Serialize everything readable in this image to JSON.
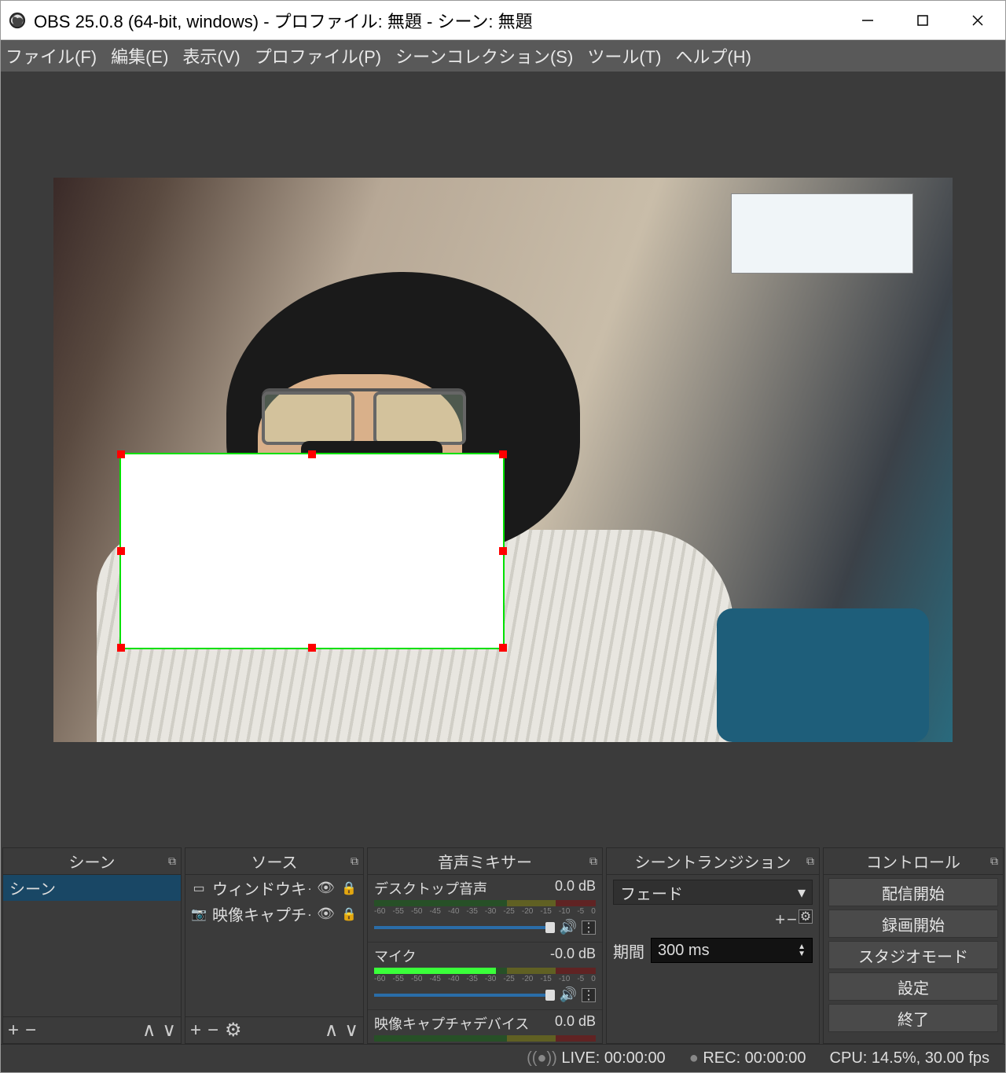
{
  "window": {
    "title": "OBS 25.0.8 (64-bit, windows) - プロファイル: 無題 - シーン: 無題"
  },
  "menubar": [
    "ファイル(F)",
    "編集(E)",
    "表示(V)",
    "プロファイル(P)",
    "シーンコレクション(S)",
    "ツール(T)",
    "ヘルプ(H)"
  ],
  "docks": {
    "scenes": {
      "title": "シーン",
      "items": [
        "シーン"
      ]
    },
    "sources": {
      "title": "ソース",
      "items": [
        {
          "icon": "window",
          "name": "ウィンドウキャプチャ",
          "visible": true,
          "locked": true
        },
        {
          "icon": "camera",
          "name": "映像キャプチャデバイス",
          "visible": true,
          "locked": true
        }
      ]
    },
    "mixer": {
      "title": "音声ミキサー",
      "ticks": [
        "-60",
        "-55",
        "-50",
        "-45",
        "-40",
        "-35",
        "-30",
        "-25",
        "-20",
        "-15",
        "-10",
        "-5",
        "0"
      ],
      "channels": [
        {
          "name": "デスクトップ音声",
          "db": "0.0 dB",
          "level": 0.0
        },
        {
          "name": "マイク",
          "db": "-0.0 dB",
          "level": 0.55
        },
        {
          "name": "映像キャプチャデバイス",
          "db": "0.0 dB",
          "level": 0.0
        }
      ]
    },
    "transitions": {
      "title": "シーントランジション",
      "selected": "フェード",
      "duration_label": "期間",
      "duration_value": "300 ms"
    },
    "controls": {
      "title": "コントロール",
      "buttons": [
        "配信開始",
        "録画開始",
        "スタジオモード",
        "設定",
        "終了"
      ]
    }
  },
  "statusbar": {
    "live": "LIVE: 00:00:00",
    "rec": "REC: 00:00:00",
    "cpu": "CPU: 14.5%, 30.00 fps"
  }
}
